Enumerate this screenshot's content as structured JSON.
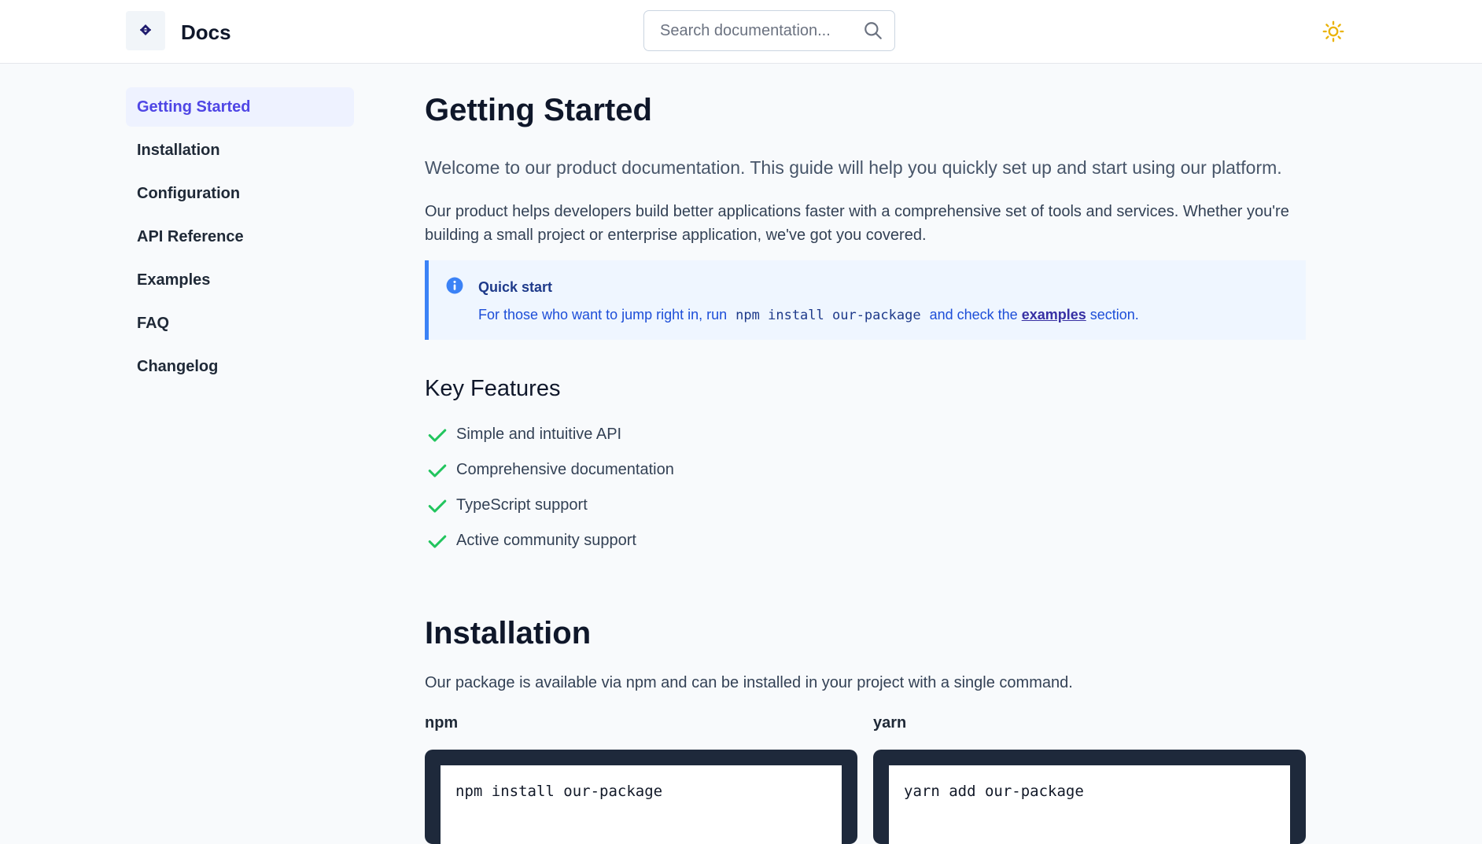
{
  "header": {
    "brand": "Docs",
    "search_placeholder": "Search documentation...",
    "logo_icon": "diamond-logo-icon",
    "search_icon": "search-icon",
    "theme_icon": "sun-icon"
  },
  "sidebar": {
    "items": [
      {
        "label": "Getting Started",
        "active": true
      },
      {
        "label": "Installation"
      },
      {
        "label": "Configuration"
      },
      {
        "label": "API Reference"
      },
      {
        "label": "Examples"
      },
      {
        "label": "FAQ"
      },
      {
        "label": "Changelog"
      }
    ]
  },
  "main": {
    "title": "Getting Started",
    "lead": "Welcome to our product documentation. This guide will help you quickly set up and start using our platform.",
    "intro": "Our product helps developers build better applications faster with a comprehensive set of tools and services. Whether you're building a small project or enterprise application, we've got you covered.",
    "callout": {
      "icon": "info-icon",
      "title": "Quick start",
      "before": "For those who want to jump right in, run",
      "code": "npm install our-package",
      "middle": "and check the",
      "link": "examples",
      "after": "section."
    },
    "features_title": "Key Features",
    "features": [
      "Simple and intuitive API",
      "Comprehensive documentation",
      "TypeScript support",
      "Active community support"
    ],
    "installation": {
      "title": "Installation",
      "text": "Our package is available via npm and can be installed in your project with a single command.",
      "npm_label": "npm",
      "npm_cmd": "npm install our-package",
      "yarn_label": "yarn",
      "yarn_cmd": "yarn add our-package"
    }
  },
  "colors": {
    "accent": "#4f46e5",
    "check": "#22c55e",
    "info": "#3b82f6",
    "sun": "#eab308"
  }
}
